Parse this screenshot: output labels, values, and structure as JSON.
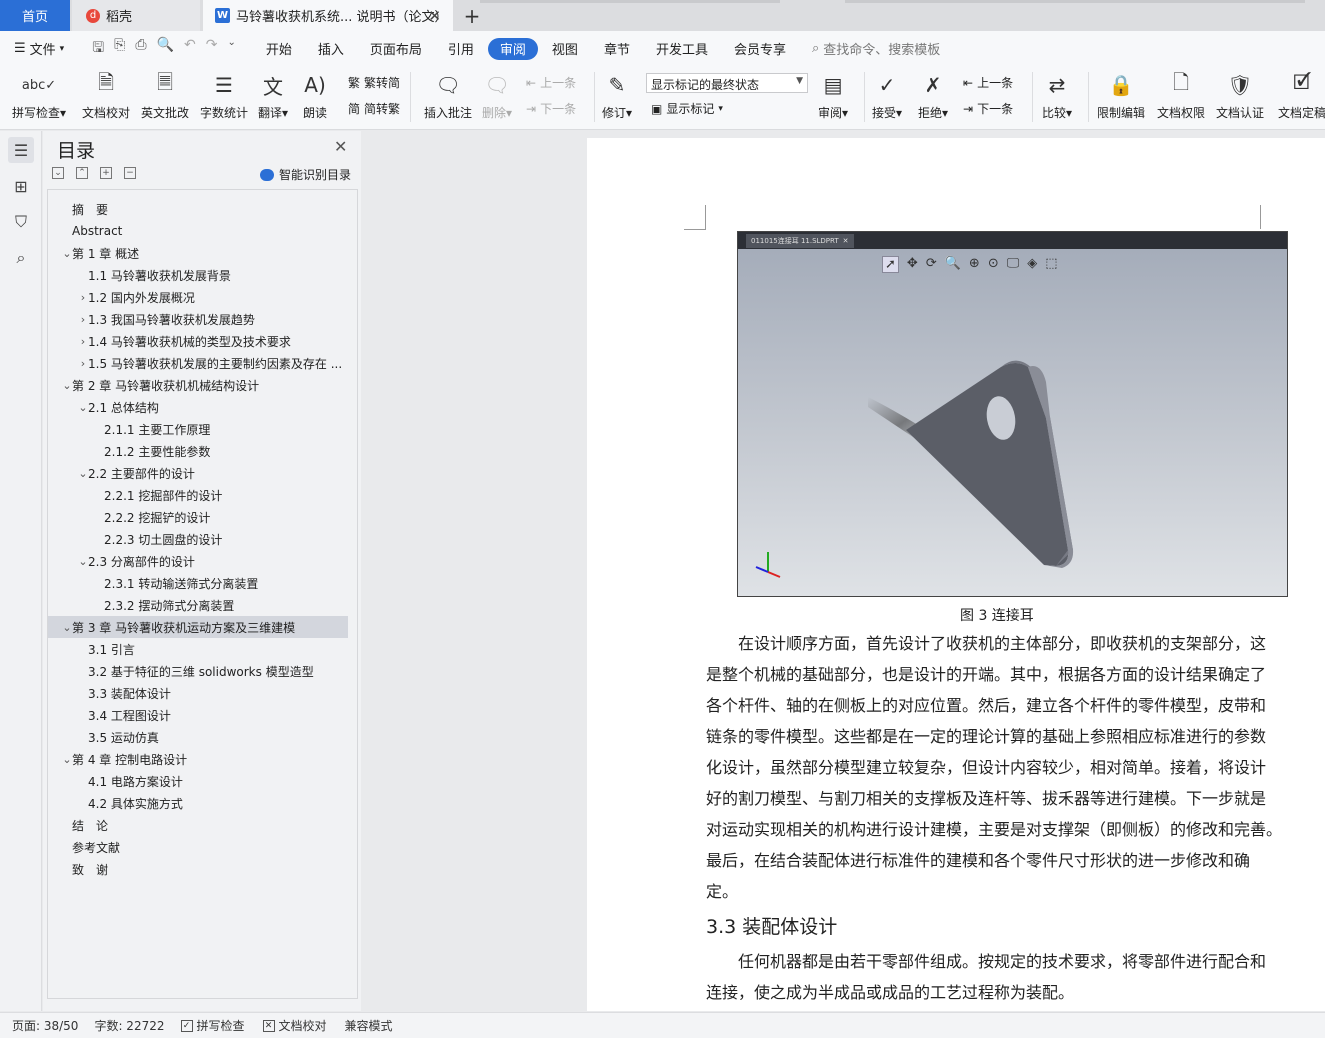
{
  "tabs": {
    "home": "首页",
    "daoke": "稻壳",
    "doc": "马铃薯收获机系统... 说明书（论文）",
    "close": "✕",
    "add": "+"
  },
  "menubar": {
    "file": "文件",
    "items": [
      "开始",
      "插入",
      "页面布局",
      "引用",
      "审阅",
      "视图",
      "章节",
      "开发工具",
      "会员专享"
    ],
    "active": "审阅",
    "search": "查找命令、搜索模板"
  },
  "ribbon": {
    "spell": "拼写检查",
    "proof": "文档校对",
    "english": "英文批改",
    "wordcount": "字数统计",
    "translate": "翻译",
    "read": "朗读",
    "trad": "繁转简",
    "simp": "简转繁",
    "insert_comment": "插入批注",
    "delete": "删除",
    "prev": "上一条",
    "next": "下一条",
    "revise": "修订",
    "markup_state": "显示标记的最终状态",
    "show_markup": "显示标记",
    "review": "审阅",
    "accept": "接受",
    "reject": "拒绝",
    "prev2": "上一条",
    "next2": "下一条",
    "compare": "比较",
    "restrict": "限制编辑",
    "permission": "文档权限",
    "certify": "文档认证",
    "finalize": "文档定稿"
  },
  "toc": {
    "title": "目录",
    "close": "✕",
    "smart": "智能识别目录",
    "items": [
      {
        "text": "摘　要",
        "level": 0,
        "chev": ""
      },
      {
        "text": "Abstract",
        "level": 0,
        "chev": ""
      },
      {
        "text": "第 1 章  概述",
        "level": 0,
        "chev": "down"
      },
      {
        "text": "1.1 马铃薯收获机发展背景",
        "level": 1,
        "chev": ""
      },
      {
        "text": "1.2 国内外发展概况",
        "level": 1,
        "chev": "right"
      },
      {
        "text": "1.3 我国马铃薯收获机发展趋势",
        "level": 1,
        "chev": "right"
      },
      {
        "text": "1.4 马铃薯收获机械的类型及技术要求",
        "level": 1,
        "chev": "right"
      },
      {
        "text": "1.5 马铃薯收获机发展的主要制约因素及存在 ...",
        "level": 1,
        "chev": "right"
      },
      {
        "text": "第 2 章  马铃薯收获机机械结构设计",
        "level": 0,
        "chev": "down"
      },
      {
        "text": "2.1 总体结构",
        "level": 1,
        "chev": "down"
      },
      {
        "text": "2.1.1 主要工作原理",
        "level": 2,
        "chev": ""
      },
      {
        "text": "2.1.2 主要性能参数",
        "level": 2,
        "chev": ""
      },
      {
        "text": "2.2 主要部件的设计",
        "level": 1,
        "chev": "down"
      },
      {
        "text": "2.2.1 挖掘部件的设计",
        "level": 2,
        "chev": ""
      },
      {
        "text": "2.2.2 挖掘铲的设计",
        "level": 2,
        "chev": ""
      },
      {
        "text": "2.2.3 切土圆盘的设计",
        "level": 2,
        "chev": ""
      },
      {
        "text": "2.3 分离部件的设计",
        "level": 1,
        "chev": "down"
      },
      {
        "text": "2.3.1 转动输送筛式分离装置",
        "level": 2,
        "chev": ""
      },
      {
        "text": "2.3.2 摆动筛式分离装置",
        "level": 2,
        "chev": ""
      },
      {
        "text": "第 3 章  马铃薯收获机运动方案及三维建模",
        "level": 0,
        "chev": "down",
        "selected": true
      },
      {
        "text": "3.1 引言",
        "level": 1,
        "chev": ""
      },
      {
        "text": "3.2 基于特征的三维 solidworks 模型造型",
        "level": 1,
        "chev": ""
      },
      {
        "text": "3.3 装配体设计",
        "level": 1,
        "chev": ""
      },
      {
        "text": "3.4 工程图设计",
        "level": 1,
        "chev": ""
      },
      {
        "text": "3.5 运动仿真",
        "level": 1,
        "chev": ""
      },
      {
        "text": "第 4 章  控制电路设计",
        "level": 0,
        "chev": "down"
      },
      {
        "text": "4.1 电路方案设计",
        "level": 1,
        "chev": ""
      },
      {
        "text": "4.2 具体实施方式",
        "level": 1,
        "chev": ""
      },
      {
        "text": "结　论",
        "level": 0,
        "chev": ""
      },
      {
        "text": "参考文献",
        "level": 0,
        "chev": ""
      },
      {
        "text": "致　谢",
        "level": 0,
        "chev": ""
      }
    ]
  },
  "document": {
    "cad_tab": "011015连接耳 11.SLDPRT",
    "caption": "图 3  连接耳",
    "lines1": [
      "　　在设计顺序方面，首先设计了收获机的主体部分，即收获机的支架部分，这",
      "是整个机械的基础部分，也是设计的开端。其中，根据各方面的设计结果确定了",
      "各个杆件、轴的在侧板上的对应位置。然后，建立各个杆件的零件模型，皮带和",
      "链条的零件模型。这些都是在一定的理论计算的基础上参照相应标准进行的参数",
      "化设计，虽然部分模型建立较复杂，但设计内容较少，相对简单。接着，将设计",
      "好的割刀模型、与割刀相关的支撑板及连杆等、拔禾器等进行建模。下一步就是",
      "对运动实现相关的机构进行设计建模，主要是对支撑架（即侧板）的修改和完善。",
      "最后，在结合装配体进行标准件的建模和各个零件尺寸形状的进一步修改和确",
      "定。"
    ],
    "heading": "3.3 装配体设计",
    "lines2": [
      "　　任何机器都是由若干零部件组成。按规定的技术要求，将零部件进行配合和",
      "连接，使之成为半成品或成品的工艺过程称为装配。"
    ]
  },
  "status": {
    "page": "页面: 38/50",
    "words": "字数: 22722",
    "spell": "拼写检查",
    "proof": "文档校对",
    "compat": "兼容模式"
  },
  "colors": {
    "accent": "#2b6fd6"
  }
}
